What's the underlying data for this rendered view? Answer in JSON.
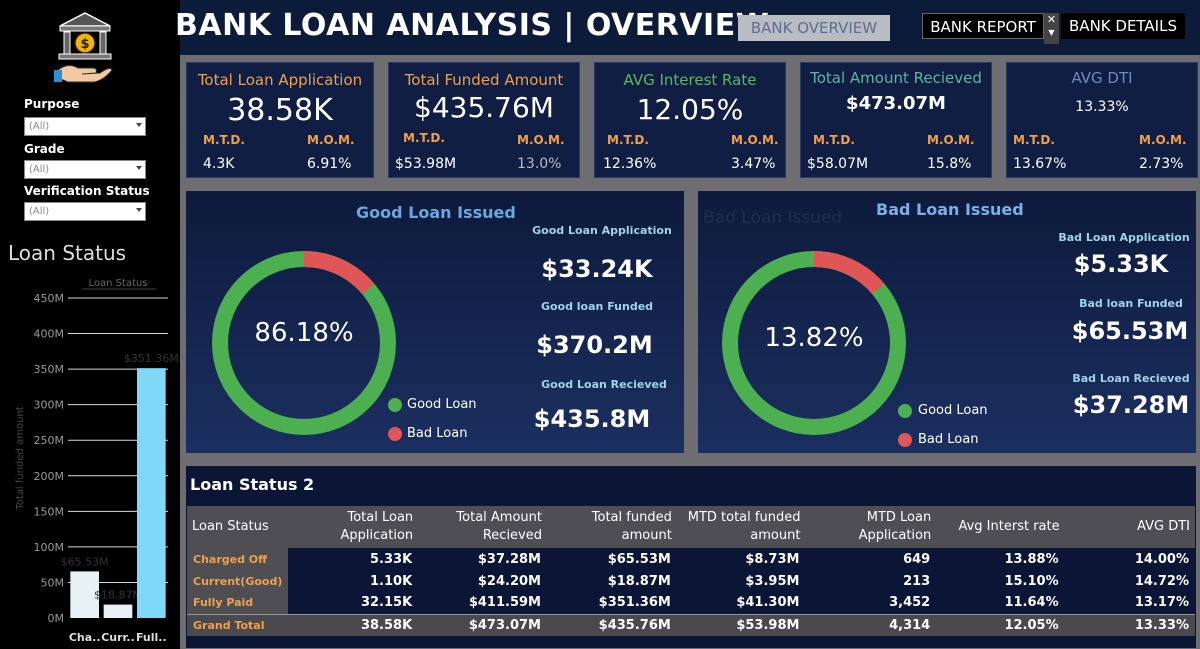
{
  "title": "BANK LOAN ANALYSIS | OVERVIEW",
  "nav": {
    "overview": "BANK OVERVIEW",
    "report": "BANK REPORT",
    "details": "BANK DETAILS"
  },
  "filters": [
    {
      "label": "Purpose",
      "value": "(All)"
    },
    {
      "label": "Grade",
      "value": "(All)"
    },
    {
      "label": "Verification Status",
      "value": "(All)"
    }
  ],
  "side_chart_title": "Loan Status",
  "chart_data": {
    "type": "bar",
    "title": "Loan Status",
    "ylabel": "Total funded amount",
    "categories": [
      "Cha..",
      "Curr..",
      "Full.."
    ],
    "values": [
      65.53,
      18.87,
      351.36
    ],
    "data_labels": [
      "$65.53M",
      "$18.87M",
      "$351.36M"
    ],
    "ylim": [
      0,
      450
    ],
    "yticks": [
      "0M",
      "50M",
      "100M",
      "150M",
      "200M",
      "250M",
      "300M",
      "350M",
      "400M",
      "450M"
    ],
    "colors": [
      "#e8f1f6",
      "#e8f1f6",
      "#7fd8f7"
    ]
  },
  "kpis": [
    {
      "title": "Total Loan Application",
      "value": "38.58K",
      "mtd_label": "M.T.D.",
      "mtd": "4.3K",
      "mom_label": "M.O.M.",
      "mom": "6.91%"
    },
    {
      "title": "Total Funded Amount",
      "value": "$435.76M",
      "mtd_label": "M.T.D.",
      "mtd": "$53.98M",
      "mom_label": "M.O.M.",
      "mom": "13.0%"
    },
    {
      "title": "AVG Interest Rate",
      "value": "12.05%",
      "mtd_label": "M.T.D.",
      "mtd": "12.36%",
      "mom_label": "M.O.M.",
      "mom": "3.47%"
    },
    {
      "title": "Total Amount Recieved",
      "value": "$473.07M",
      "mtd_label": "M.T.D.",
      "mtd": "$58.07M",
      "mom_label": "M.O.M.",
      "mom": "15.8%"
    },
    {
      "title": "AVG DTI",
      "value": "13.33%",
      "mtd_label": "M.T.D.",
      "mtd": "13.67%",
      "mom_label": "M.O.M.",
      "mom": "2.73%"
    }
  ],
  "good": {
    "title": "Good Loan Issued",
    "percent": "86.18%",
    "percent_value": 86.18,
    "app_label": "Good Loan Application",
    "app": "$33.24K",
    "funded_label": "Good loan Funded",
    "funded": "$370.2M",
    "received_label": "Good Loan Recieved",
    "received": "$435.8M"
  },
  "bad": {
    "title": "Bad Loan Issued",
    "ghost_title": "Bad Loan Issued",
    "percent": "13.82%",
    "percent_value": 13.82,
    "app_label": "Bad Loan Application",
    "app": "$5.33K",
    "funded_label": "Bad loan Funded",
    "funded": "$65.53M",
    "received_label": "Bad Loan Recieved",
    "received": "$37.28M"
  },
  "legend": {
    "good": "Good Loan",
    "bad": "Bad Loan"
  },
  "colors": {
    "good": "#4caf50",
    "bad": "#e05656",
    "accent": "#f0a04b"
  },
  "table": {
    "title": "Loan Status 2",
    "headers": [
      "Loan Status",
      "Total Loan Application",
      "Total Amount Recieved",
      "Total funded amount",
      "MTD total funded amount",
      "MTD Loan Application",
      "Avg Interst rate",
      "AVG DTI"
    ],
    "rows": [
      [
        "Charged Off",
        "5.33K",
        "$37.28M",
        "$65.53M",
        "$8.73M",
        "649",
        "13.88%",
        "14.00%"
      ],
      [
        "Current(Good)",
        "1.10K",
        "$24.20M",
        "$18.87M",
        "$3.95M",
        "213",
        "15.10%",
        "14.72%"
      ],
      [
        "Fully Paid",
        "32.15K",
        "$411.59M",
        "$351.36M",
        "$41.30M",
        "3,452",
        "11.64%",
        "13.17%"
      ]
    ],
    "total": [
      "Grand Total",
      "38.58K",
      "$473.07M",
      "$435.76M",
      "$53.98M",
      "4,314",
      "12.05%",
      "13.33%"
    ]
  }
}
